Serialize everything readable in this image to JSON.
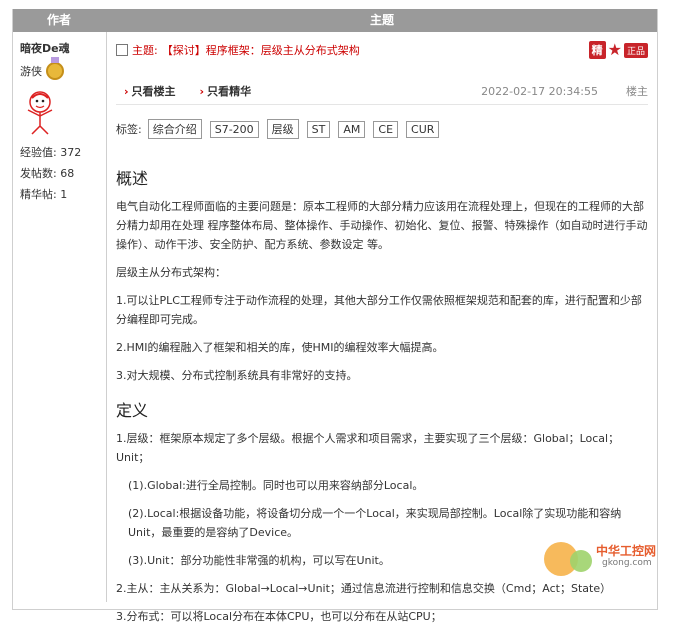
{
  "header": {
    "author_col": "作者",
    "topic_col": "主题"
  },
  "author": {
    "name": "暗夜De魂",
    "rank": "游侠",
    "stats": [
      {
        "label": "经验值:",
        "value": "372"
      },
      {
        "label": "发帖数:",
        "value": "68"
      },
      {
        "label": "精华帖:",
        "value": "1"
      }
    ]
  },
  "post": {
    "title_label": "主题:",
    "title": "【探讨】程序框架：层级主从分布式架构",
    "badges": {
      "jing": "精",
      "zc": "正品"
    },
    "filters": [
      "只看楼主",
      "只看精华"
    ],
    "timestamp": "2022-02-17 20:34:55",
    "floor": "楼主",
    "tags_label": "标签:",
    "tags": [
      "综合介绍",
      "S7-200",
      "层级",
      "ST",
      "AM",
      "CE",
      "CUR"
    ]
  },
  "content": {
    "h_overview": "概述",
    "p1": "电气自动化工程师面临的主要问题是：原本工程师的大部分精力应该用在流程处理上，但现在的工程师的大部分精力却用在处理 程序整体布局、整体操作、手动操作、初始化、复位、报警、特殊操作（如自动时进行手动操作）、动作干涉、安全防护、配方系统、参数设定 等。",
    "p2": "层级主从分布式架构：",
    "p3": "1.可以让PLC工程师专注于动作流程的处理，其他大部分工作仅需依照框架规范和配套的库，进行配置和少部分编程即可完成。",
    "p4": "2.HMI的编程融入了框架和相关的库，使HMI的编程效率大幅提高。",
    "p5": "3.对大规模、分布式控制系统具有非常好的支持。",
    "h_def": "定义",
    "d1": "1.层级：框架原本规定了多个层级。根据个人需求和项目需求，主要实现了三个层级：Global；Local；Unit；",
    "d2": "(1).Global:进行全局控制。同时也可以用来容纳部分Local。",
    "d3": "(2).Local:根据设备功能，将设备切分成一个一个Local，来实现局部控制。Local除了实现功能和容纳Unit，最重要的是容纳了Device。",
    "d4": "(3).Unit：部分功能性非常强的机构，可以写在Unit。",
    "d5": "2.主从：主从关系为：Global→Local→Unit；通过信息流进行控制和信息交换（Cmd；Act；State）",
    "d6": "3.分布式：可以将Local分布在本体CPU，也可以分布在从站CPU；"
  },
  "watermark": {
    "line1": "中华工控网",
    "line2": "gkong.com"
  },
  "colors": {
    "header_bg": "#9a9a9a",
    "accent_red": "#c00000",
    "badge_red": "#c8242a"
  }
}
